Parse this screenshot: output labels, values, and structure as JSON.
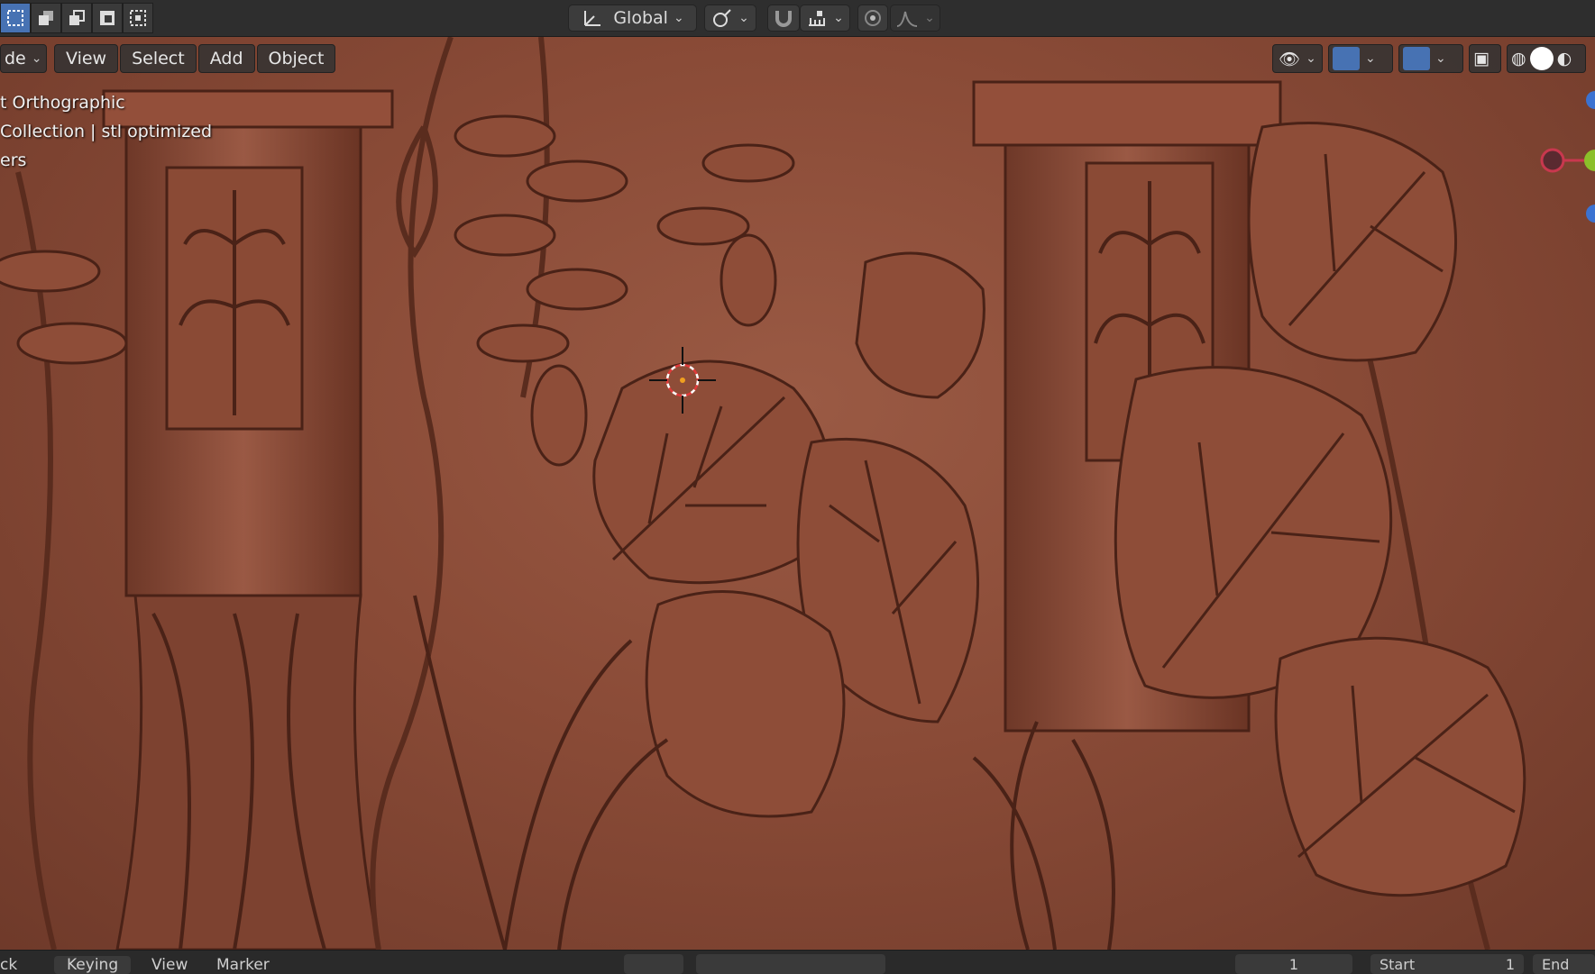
{
  "toolbar": {
    "orientation_label": "Global",
    "pivot_icon": "pivot-icon",
    "snap_icon": "snap-magnet-icon",
    "proportional_icon": "proportional-edit-icon",
    "falloff_icon": "falloff-curve-icon"
  },
  "viewport_header": {
    "mode_label": "de",
    "menu": [
      "View",
      "Select",
      "Add",
      "Object"
    ]
  },
  "overlay": {
    "line1": "t Orthographic",
    "line2": "Collection | stl optimized",
    "line3": "ers"
  },
  "timeline": {
    "items": [
      "ck",
      "Keying",
      "View",
      "Marker"
    ],
    "current_frame": "1",
    "start_label": "Start",
    "start_value": "1",
    "end_label": "End"
  },
  "colors": {
    "accent": "#4772b3",
    "relief": "#8a4b37",
    "gizmo_x": "#c8384e",
    "gizmo_y": "#8bbf2a",
    "gizmo_z": "#3b72d1"
  }
}
